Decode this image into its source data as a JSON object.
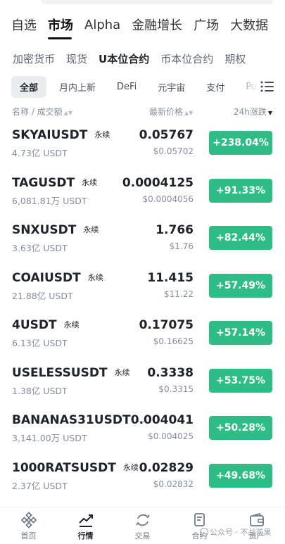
{
  "top_tabs": [
    {
      "label": "自选"
    },
    {
      "label": "市场"
    },
    {
      "label": "Alpha"
    },
    {
      "label": "金融增长"
    },
    {
      "label": "广场"
    },
    {
      "label": "大数据"
    }
  ],
  "sub_tabs": [
    {
      "label": "加密货币"
    },
    {
      "label": "现货"
    },
    {
      "label": "U本位合约"
    },
    {
      "label": "币本位合约"
    },
    {
      "label": "期权"
    }
  ],
  "chips": [
    {
      "label": "全部"
    },
    {
      "label": "月内上新"
    },
    {
      "label": "DeFi"
    },
    {
      "label": "元宇宙"
    },
    {
      "label": "支付"
    },
    {
      "label": "Po"
    }
  ],
  "columns": {
    "name": "名称 / 成交额",
    "price": "最新价格",
    "change": "24h涨跌"
  },
  "perpetual_label": "永续",
  "rows": [
    {
      "symbol": "SKYAIUSDT",
      "volume": "4.73亿 USDT",
      "price": "0.05767",
      "usd": "$0.05702",
      "change": "+238.04%"
    },
    {
      "symbol": "TAGUSDT",
      "volume": "6,081.81万 USDT",
      "price": "0.0004125",
      "usd": "$0.0004056",
      "change": "+91.33%"
    },
    {
      "symbol": "SNXUSDT",
      "volume": "3.63亿 USDT",
      "price": "1.766",
      "usd": "$1.76",
      "change": "+82.44%"
    },
    {
      "symbol": "COAIUSDT",
      "volume": "21.88亿 USDT",
      "price": "11.415",
      "usd": "$11.22",
      "change": "+57.49%"
    },
    {
      "symbol": "4USDT",
      "volume": "6.13亿 USDT",
      "price": "0.17075",
      "usd": "$0.16625",
      "change": "+57.14%"
    },
    {
      "symbol": "USELESSUSDT",
      "volume": "1.38亿 USDT",
      "price": "0.3338",
      "usd": "$0.3315",
      "change": "+53.75%"
    },
    {
      "symbol": "BANANAS31USDT",
      "volume": "3,141.00万 USDT",
      "price": "0.004041",
      "usd": "$0.004025",
      "change": "+50.28%",
      "perp_label": "..."
    },
    {
      "symbol": "1000RATSUSDT",
      "volume": "2.37亿 USDT",
      "price": "0.02829",
      "usd": "$0.02832",
      "change": "+49.68%"
    }
  ],
  "bottom_nav": [
    {
      "label": "首页",
      "icon": "home-icon"
    },
    {
      "label": "行情",
      "icon": "markets-icon"
    },
    {
      "label": "交易",
      "icon": "trade-icon"
    },
    {
      "label": "合约",
      "icon": "futures-icon"
    },
    {
      "label": "资产",
      "icon": "wallet-icon"
    }
  ],
  "watermark": "公众号 · 不战芒果",
  "colors": {
    "up": "#2ebd85",
    "text": "#1e2329",
    "muted": "#848e9c"
  }
}
